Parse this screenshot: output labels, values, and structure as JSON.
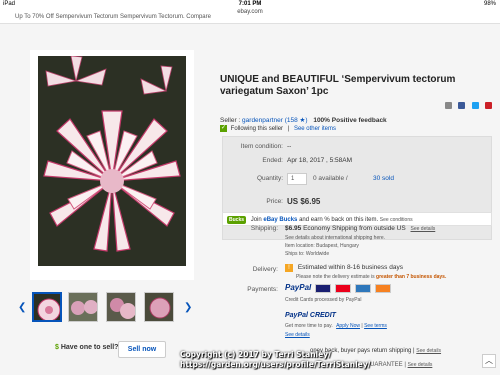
{
  "status": {
    "device": "iPad",
    "wifi": "wifi",
    "time": "7:01 PM",
    "battery": "98%"
  },
  "browser": {
    "url": "ebay.com",
    "tab_text": "Up To 70% Off Sempervivum Tectorum Sempervivum Tectorum. Compare"
  },
  "listing": {
    "title": "UNIQUE and BEAUTIFUL ‘Sempervivum tectorum variegatum Saxon’ 1pc",
    "seller_label": "Seller :",
    "seller_name": "gardenpartner",
    "feedback_count": "(158 ★)",
    "feedback_pct": "100% Positive feedback",
    "following": "Following this seller",
    "see_other": "See other items"
  },
  "panel": {
    "condition_label": "Item condition:",
    "condition_value": "--",
    "ended_label": "Ended:",
    "ended_value": "Apr 18, 2017 , 5:58AM",
    "quantity_label": "Quantity:",
    "quantity_value": "1",
    "available": "0 available /",
    "sold": "30 sold",
    "price_label": "Price:",
    "price_value": "US $6.95"
  },
  "bucks": {
    "logo": "Bucks",
    "text_pre": "Join",
    "brand": "eBay Bucks",
    "text_post": "and earn % back on this item.",
    "link": "See conditions"
  },
  "shipping": {
    "label": "Shipping:",
    "price": "$6.95",
    "desc": "Economy Shipping from outside US",
    "details": "See details",
    "line2": "See details about international shipping here.",
    "location": "Item location: Budapest, Hungary",
    "ships": "Ships to: Worldwide"
  },
  "delivery": {
    "label": "Delivery:",
    "text": "Estimated within 8-16 business days",
    "note_pre": "Please note the delivery estimate is",
    "note_highlight": "greater than 7 business days."
  },
  "payments": {
    "label": "Payments:",
    "paypal": "PayPal",
    "cards": "Credit Cards processed by PayPal",
    "credit": "PayPal CREDIT",
    "credit_text": "Get more time to pay.",
    "apply": "Apply Now",
    "terms": "See terms",
    "see_details": "See details"
  },
  "returns": {
    "text": "oney back, buyer pays return shipping |",
    "details": "See details"
  },
  "guarantee": {
    "text": "UARANTEE",
    "details": "See details"
  },
  "sell": {
    "question": "Have one to sell?",
    "button": "Sell now"
  },
  "watermark": {
    "line1": "Copyright (c) 2017 by Terri Stanley/",
    "line2": "https://garden.org/users/profile/TerriStanley/"
  },
  "colors": {
    "link": "#0654ba",
    "accent": "#5ba100",
    "paypal": "#003087"
  }
}
